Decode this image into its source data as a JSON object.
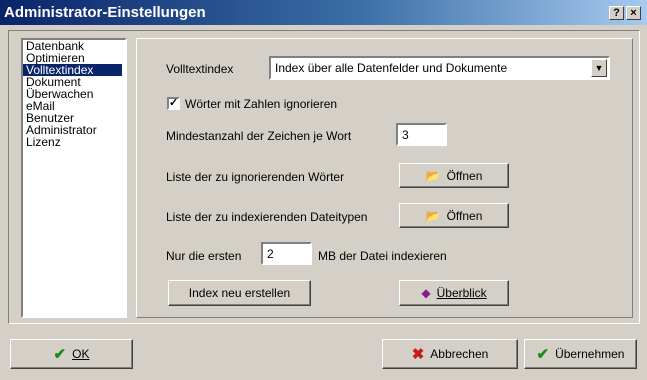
{
  "window": {
    "title": "Administrator-Einstellungen",
    "help_label": "?",
    "close_label": "×"
  },
  "nav": {
    "items": [
      {
        "label": "Datenbank",
        "selected": false
      },
      {
        "label": "Optimieren",
        "selected": false
      },
      {
        "label": "Volltextindex",
        "selected": true
      },
      {
        "label": "Dokument",
        "selected": false
      },
      {
        "label": "Überwachen",
        "selected": false
      },
      {
        "label": "eMail",
        "selected": false
      },
      {
        "label": "Benutzer",
        "selected": false
      },
      {
        "label": "Administrator",
        "selected": false
      },
      {
        "label": "Lizenz",
        "selected": false
      }
    ]
  },
  "panel": {
    "index_label": "Volltextindex",
    "index_value": "Index über alle Datenfelder und Dokumente",
    "ignore_numbers_label": "Wörter mit Zahlen ignorieren",
    "ignore_numbers_checked": true,
    "min_chars_label": "Mindestanzahl der Zeichen je Wort",
    "min_chars_value": "3",
    "ignore_words_label": "Liste der zu ignorierenden Wörter",
    "open_label": "Öffnen",
    "filetypes_label": "Liste der zu indexierenden Dateitypen",
    "first_label": "Nur die ersten",
    "first_value": "2",
    "first_suffix": "MB der Datei indexieren",
    "rebuild_label": "Index neu erstellen",
    "overview_label": "Überblick"
  },
  "footer": {
    "ok_label": "OK",
    "cancel_label": "Abbrechen",
    "apply_label": "Übernehmen"
  }
}
